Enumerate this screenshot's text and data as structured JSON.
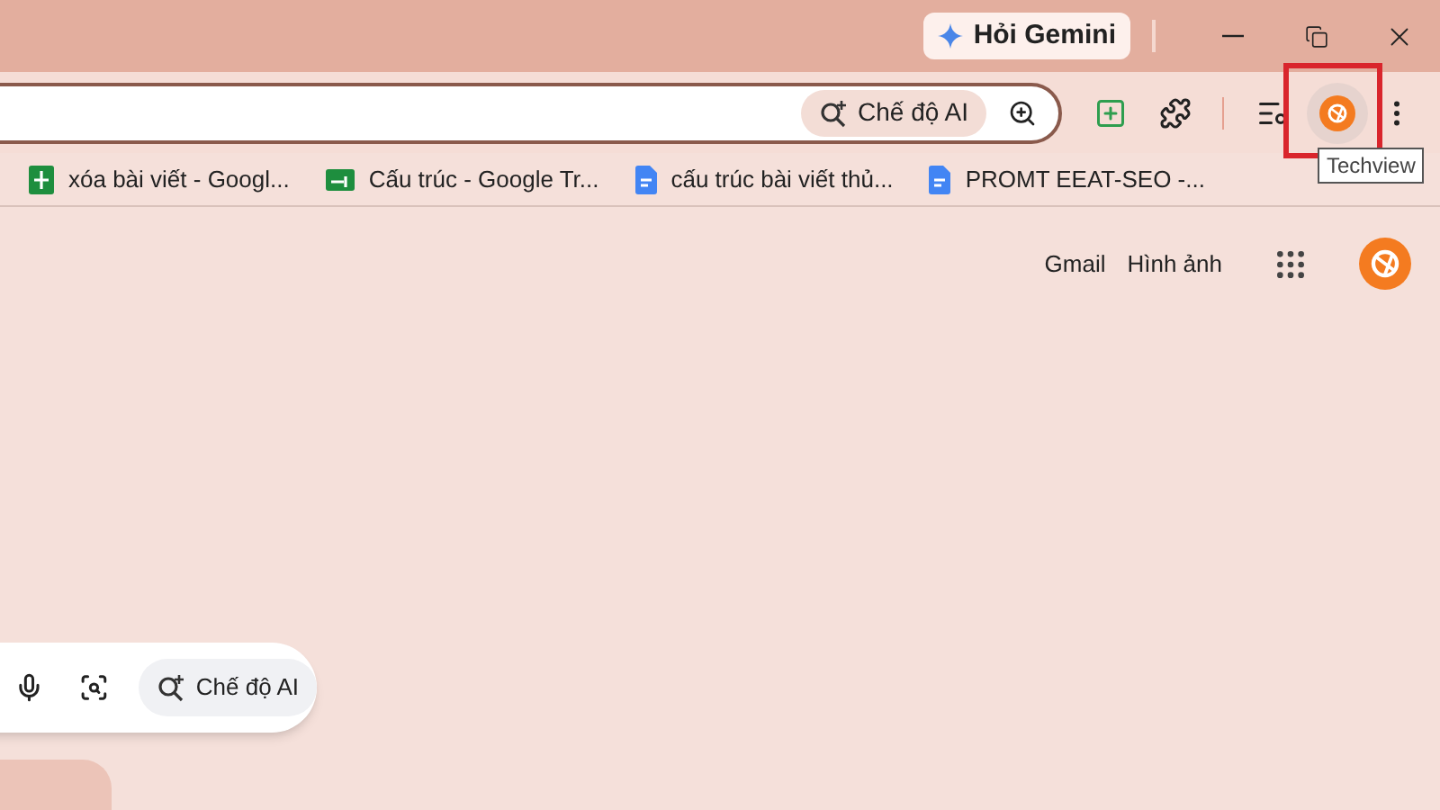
{
  "title_bar": {
    "gemini_button": "Hỏi Gemini"
  },
  "toolbar": {
    "ai_mode_chip": "Chế độ AI",
    "profile_highlighted": true,
    "tooltip": "Techview"
  },
  "bookmarks": [
    {
      "kind": "sheets",
      "label": "xóa bài viết - Googl..."
    },
    {
      "kind": "slides",
      "label": "Cấu trúc - Google Tr..."
    },
    {
      "kind": "docs",
      "label": "cấu trúc bài viết thủ..."
    },
    {
      "kind": "docs",
      "label": "PROMT EEAT-SEO -..."
    }
  ],
  "header_links": [
    "Gmail",
    "Hình ảnh"
  ],
  "search": {
    "ai_mode_chip": "Chế độ AI"
  }
}
